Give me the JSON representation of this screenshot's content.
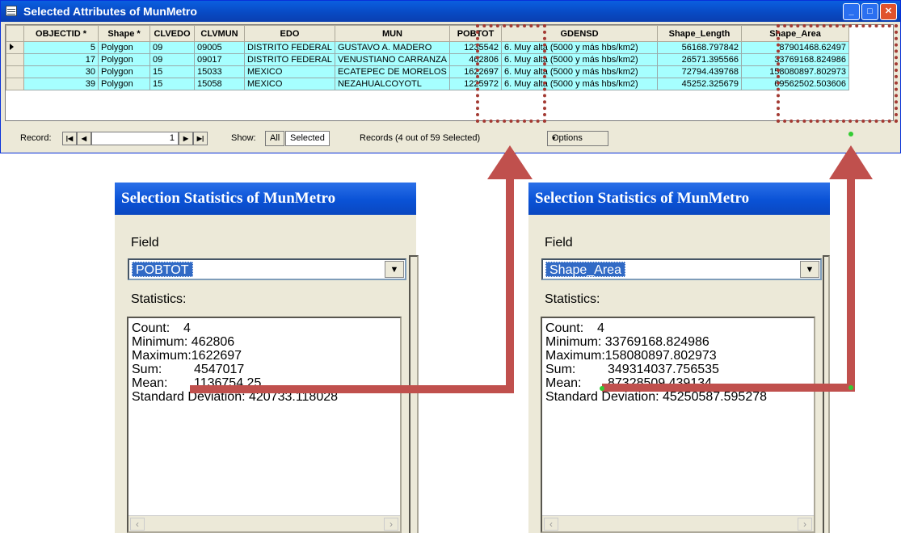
{
  "table_window": {
    "title": "Selected Attributes of MunMetro",
    "columns": [
      "",
      "OBJECTID *",
      "Shape *",
      "CLVEDO",
      "CLVMUN",
      "EDO",
      "MUN",
      "POBTOT",
      "GDENSD",
      "Shape_Length",
      "Shape_Area"
    ],
    "rows": [
      {
        "objectid": "5",
        "shape": "Polygon",
        "clvedo": "09",
        "clvmun": "09005",
        "edo": "DISTRITO FEDERAL",
        "mun": "GUSTAVO A. MADERO",
        "pobtot": "1235542",
        "gdensd": "6. Muy alta (5000 y más hbs/km2)",
        "length": "56168.797842",
        "area": "87901468.62497"
      },
      {
        "objectid": "17",
        "shape": "Polygon",
        "clvedo": "09",
        "clvmun": "09017",
        "edo": "DISTRITO FEDERAL",
        "mun": "VENUSTIANO CARRANZA",
        "pobtot": "462806",
        "gdensd": "6. Muy alta (5000 y más hbs/km2)",
        "length": "26571.395566",
        "area": "33769168.824986"
      },
      {
        "objectid": "30",
        "shape": "Polygon",
        "clvedo": "15",
        "clvmun": "15033",
        "edo": "MEXICO",
        "mun": "ECATEPEC DE MORELOS",
        "pobtot": "1622697",
        "gdensd": "6. Muy alta (5000 y más hbs/km2)",
        "length": "72794.439768",
        "area": "158080897.802973"
      },
      {
        "objectid": "39",
        "shape": "Polygon",
        "clvedo": "15",
        "clvmun": "15058",
        "edo": "MEXICO",
        "mun": "NEZAHUALCOYOTL",
        "pobtot": "1225972",
        "gdensd": "6. Muy alta (5000 y más hbs/km2)",
        "length": "45252.325679",
        "area": "69562502.503606"
      }
    ],
    "nav": {
      "record_label": "Record:",
      "record_value": "1",
      "show_label": "Show:",
      "all_label": "All",
      "selected_label": "Selected",
      "records_text": "Records (4 out of 59 Selected)",
      "options_label": "Options"
    }
  },
  "dialog_left": {
    "title": "Selection Statistics of MunMetro",
    "field_label": "Field",
    "field_value": "POBTOT",
    "statistics_label": "Statistics:",
    "stats": [
      {
        "k": "Count:",
        "v": "4"
      },
      {
        "k": "Minimum:",
        "v": "462806"
      },
      {
        "k": "Maximum:",
        "v": "1622697"
      },
      {
        "k": "Sum:",
        "v": "4547017"
      },
      {
        "k": "Mean:",
        "v": "1136754.25"
      },
      {
        "k": "Standard Deviation:",
        "v": "420733.118028"
      }
    ]
  },
  "dialog_right": {
    "title": "Selection Statistics of MunMetro",
    "field_label": "Field",
    "field_value": "Shape_Area",
    "statistics_label": "Statistics:",
    "stats": [
      {
        "k": "Count:",
        "v": "4"
      },
      {
        "k": "Minimum:",
        "v": "33769168.824986"
      },
      {
        "k": "Maximum:",
        "v": "158080897.802973"
      },
      {
        "k": "Sum:",
        "v": "349314037.756535"
      },
      {
        "k": "Mean:",
        "v": "87328509.439134"
      },
      {
        "k": "Standard Deviation:",
        "v": "45250587.595278"
      }
    ]
  },
  "colors": {
    "selected_row": "#a6ffff",
    "annotation": "#c0504d",
    "dotted_box": "#a33a33"
  }
}
